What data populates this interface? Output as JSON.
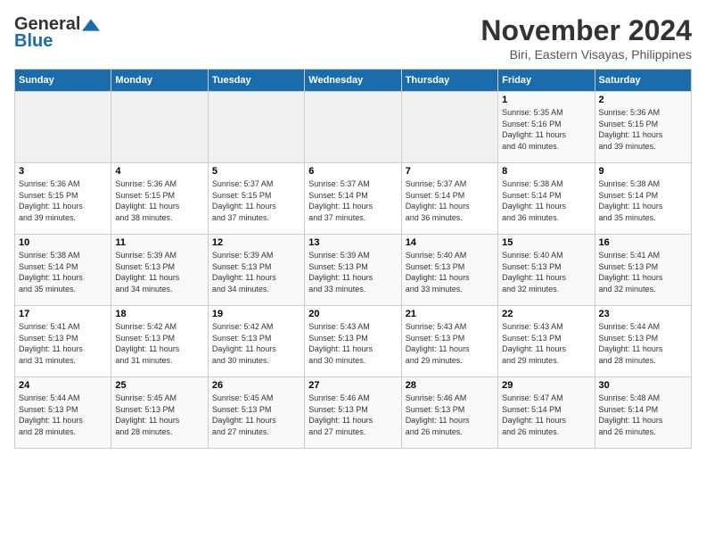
{
  "logo": {
    "line1": "General",
    "line2": "Blue"
  },
  "title": "November 2024",
  "location": "Biri, Eastern Visayas, Philippines",
  "weekdays": [
    "Sunday",
    "Monday",
    "Tuesday",
    "Wednesday",
    "Thursday",
    "Friday",
    "Saturday"
  ],
  "weeks": [
    [
      {
        "day": "",
        "info": ""
      },
      {
        "day": "",
        "info": ""
      },
      {
        "day": "",
        "info": ""
      },
      {
        "day": "",
        "info": ""
      },
      {
        "day": "",
        "info": ""
      },
      {
        "day": "1",
        "info": "Sunrise: 5:35 AM\nSunset: 5:16 PM\nDaylight: 11 hours\nand 40 minutes."
      },
      {
        "day": "2",
        "info": "Sunrise: 5:36 AM\nSunset: 5:15 PM\nDaylight: 11 hours\nand 39 minutes."
      }
    ],
    [
      {
        "day": "3",
        "info": "Sunrise: 5:36 AM\nSunset: 5:15 PM\nDaylight: 11 hours\nand 39 minutes."
      },
      {
        "day": "4",
        "info": "Sunrise: 5:36 AM\nSunset: 5:15 PM\nDaylight: 11 hours\nand 38 minutes."
      },
      {
        "day": "5",
        "info": "Sunrise: 5:37 AM\nSunset: 5:15 PM\nDaylight: 11 hours\nand 37 minutes."
      },
      {
        "day": "6",
        "info": "Sunrise: 5:37 AM\nSunset: 5:14 PM\nDaylight: 11 hours\nand 37 minutes."
      },
      {
        "day": "7",
        "info": "Sunrise: 5:37 AM\nSunset: 5:14 PM\nDaylight: 11 hours\nand 36 minutes."
      },
      {
        "day": "8",
        "info": "Sunrise: 5:38 AM\nSunset: 5:14 PM\nDaylight: 11 hours\nand 36 minutes."
      },
      {
        "day": "9",
        "info": "Sunrise: 5:38 AM\nSunset: 5:14 PM\nDaylight: 11 hours\nand 35 minutes."
      }
    ],
    [
      {
        "day": "10",
        "info": "Sunrise: 5:38 AM\nSunset: 5:14 PM\nDaylight: 11 hours\nand 35 minutes."
      },
      {
        "day": "11",
        "info": "Sunrise: 5:39 AM\nSunset: 5:13 PM\nDaylight: 11 hours\nand 34 minutes."
      },
      {
        "day": "12",
        "info": "Sunrise: 5:39 AM\nSunset: 5:13 PM\nDaylight: 11 hours\nand 34 minutes."
      },
      {
        "day": "13",
        "info": "Sunrise: 5:39 AM\nSunset: 5:13 PM\nDaylight: 11 hours\nand 33 minutes."
      },
      {
        "day": "14",
        "info": "Sunrise: 5:40 AM\nSunset: 5:13 PM\nDaylight: 11 hours\nand 33 minutes."
      },
      {
        "day": "15",
        "info": "Sunrise: 5:40 AM\nSunset: 5:13 PM\nDaylight: 11 hours\nand 32 minutes."
      },
      {
        "day": "16",
        "info": "Sunrise: 5:41 AM\nSunset: 5:13 PM\nDaylight: 11 hours\nand 32 minutes."
      }
    ],
    [
      {
        "day": "17",
        "info": "Sunrise: 5:41 AM\nSunset: 5:13 PM\nDaylight: 11 hours\nand 31 minutes."
      },
      {
        "day": "18",
        "info": "Sunrise: 5:42 AM\nSunset: 5:13 PM\nDaylight: 11 hours\nand 31 minutes."
      },
      {
        "day": "19",
        "info": "Sunrise: 5:42 AM\nSunset: 5:13 PM\nDaylight: 11 hours\nand 30 minutes."
      },
      {
        "day": "20",
        "info": "Sunrise: 5:43 AM\nSunset: 5:13 PM\nDaylight: 11 hours\nand 30 minutes."
      },
      {
        "day": "21",
        "info": "Sunrise: 5:43 AM\nSunset: 5:13 PM\nDaylight: 11 hours\nand 29 minutes."
      },
      {
        "day": "22",
        "info": "Sunrise: 5:43 AM\nSunset: 5:13 PM\nDaylight: 11 hours\nand 29 minutes."
      },
      {
        "day": "23",
        "info": "Sunrise: 5:44 AM\nSunset: 5:13 PM\nDaylight: 11 hours\nand 28 minutes."
      }
    ],
    [
      {
        "day": "24",
        "info": "Sunrise: 5:44 AM\nSunset: 5:13 PM\nDaylight: 11 hours\nand 28 minutes."
      },
      {
        "day": "25",
        "info": "Sunrise: 5:45 AM\nSunset: 5:13 PM\nDaylight: 11 hours\nand 28 minutes."
      },
      {
        "day": "26",
        "info": "Sunrise: 5:45 AM\nSunset: 5:13 PM\nDaylight: 11 hours\nand 27 minutes."
      },
      {
        "day": "27",
        "info": "Sunrise: 5:46 AM\nSunset: 5:13 PM\nDaylight: 11 hours\nand 27 minutes."
      },
      {
        "day": "28",
        "info": "Sunrise: 5:46 AM\nSunset: 5:13 PM\nDaylight: 11 hours\nand 26 minutes."
      },
      {
        "day": "29",
        "info": "Sunrise: 5:47 AM\nSunset: 5:14 PM\nDaylight: 11 hours\nand 26 minutes."
      },
      {
        "day": "30",
        "info": "Sunrise: 5:48 AM\nSunset: 5:14 PM\nDaylight: 11 hours\nand 26 minutes."
      }
    ]
  ]
}
